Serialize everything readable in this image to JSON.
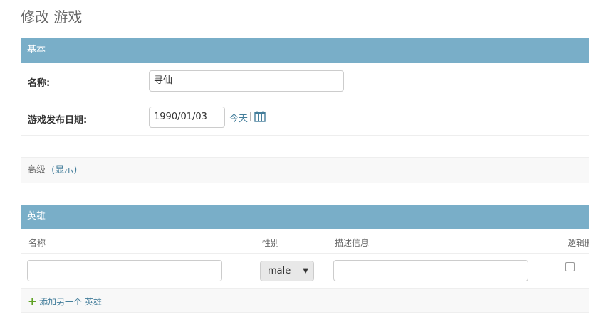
{
  "page": {
    "title": "修改 游戏"
  },
  "basic_section": {
    "header": "基本",
    "name_label": "名称:",
    "name_value": "寻仙",
    "date_label": "游戏发布日期:",
    "date_value": "1990/01/03",
    "today_link": "今天",
    "separator": "|"
  },
  "advanced_section": {
    "label": "高级",
    "toggle_link": "(显示)"
  },
  "heroes_section": {
    "header": "英雄",
    "columns": [
      "名称",
      "性别",
      "描述信息",
      "逻辑删"
    ],
    "row": {
      "name": "",
      "gender": "male",
      "description": "",
      "deleted": false
    },
    "add_link": "添加另一个 英雄"
  },
  "colors": {
    "header_bg": "#79aec8",
    "link": "#447e9b",
    "add_icon": "#5fa225"
  },
  "icons": [
    "calendar-icon",
    "plus-icon",
    "dropdown-arrow-icon"
  ]
}
